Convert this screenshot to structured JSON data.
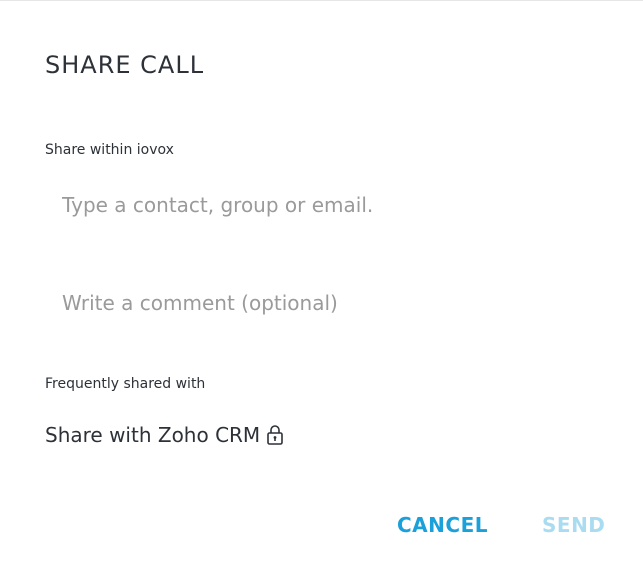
{
  "dialog": {
    "title": "SHARE CALL",
    "share_within_label": "Share within iovox",
    "contact_input": {
      "placeholder": "Type a contact, group or email.",
      "value": ""
    },
    "comment_input": {
      "placeholder": "Write a comment (optional)",
      "value": ""
    },
    "frequently_shared_label": "Frequently shared with",
    "zoho_share": {
      "label": "Share with Zoho CRM",
      "icon": "lock-icon"
    },
    "buttons": {
      "cancel": "CANCEL",
      "send": "SEND"
    }
  },
  "colors": {
    "text": "#2d3138",
    "placeholder": "#9a9a9a",
    "accent": "#1aa0db",
    "accent_disabled": "#a9dcf1"
  }
}
